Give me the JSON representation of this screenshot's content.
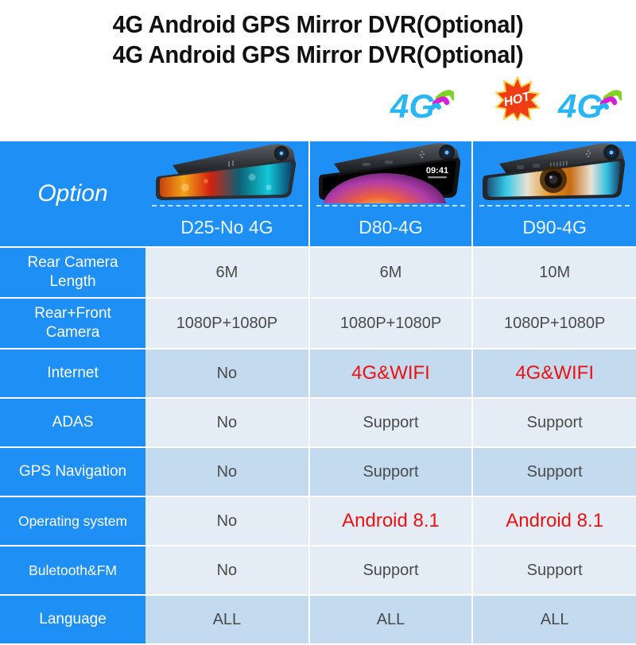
{
  "title": {
    "line1": "4G Android GPS Mirror DVR(Optional)",
    "line2": "4G Android GPS Mirror DVR(Optional)"
  },
  "badges": [
    {
      "name": "4g-badge-d80",
      "label": "4G"
    },
    {
      "name": "hot-badge-d90",
      "label": "HOT"
    },
    {
      "name": "4g-badge-d90",
      "label": "4G"
    }
  ],
  "colors": {
    "header_blue": "#1e90f5",
    "row_light": "#e4edf5",
    "row_dark": "#c3daef",
    "accent_red": "#ee1111",
    "value_text": "#4a4a4a",
    "grid_white": "#ffffff"
  },
  "table": {
    "option_header": "Option",
    "products": [
      {
        "name": "D25-No 4G"
      },
      {
        "name": "D80-4G"
      },
      {
        "name": "D90-4G"
      }
    ],
    "rows": [
      {
        "label": "Rear Camera Length",
        "label_lines": [
          "Rear Camera",
          "Length"
        ],
        "values": [
          "6M",
          "6M",
          "10M"
        ],
        "accent": [
          false,
          false,
          false
        ],
        "shade": "light"
      },
      {
        "label": "Rear+Front Camera",
        "label_lines": [
          "Rear+Front",
          "Camera"
        ],
        "values": [
          "1080P+1080P",
          "1080P+1080P",
          "1080P+1080P"
        ],
        "accent": [
          false,
          false,
          false
        ],
        "shade": "light"
      },
      {
        "label": "Internet",
        "label_lines": [
          "Internet"
        ],
        "values": [
          "No",
          "4G&WIFI",
          "4G&WIFI"
        ],
        "accent": [
          false,
          true,
          true
        ],
        "shade": "dark"
      },
      {
        "label": "ADAS",
        "label_lines": [
          "ADAS"
        ],
        "values": [
          "No",
          "Support",
          "Support"
        ],
        "accent": [
          false,
          false,
          false
        ],
        "shade": "light"
      },
      {
        "label": "GPS Navigation",
        "label_lines": [
          "GPS Navigation"
        ],
        "values": [
          "No",
          "Support",
          "Support"
        ],
        "accent": [
          false,
          false,
          false
        ],
        "shade": "dark"
      },
      {
        "label": "Operating system",
        "label_lines": [
          "Operating system"
        ],
        "values": [
          "No",
          "Android 8.1",
          "Android 8.1"
        ],
        "accent": [
          false,
          true,
          true
        ],
        "shade": "light"
      },
      {
        "label": "Buletooth&FM",
        "label_lines": [
          "Buletooth&FM"
        ],
        "values": [
          "No",
          "Support",
          "Support"
        ],
        "accent": [
          false,
          false,
          false
        ],
        "shade": "light"
      },
      {
        "label": "Language",
        "label_lines": [
          "Language"
        ],
        "values": [
          "ALL",
          "ALL",
          "ALL"
        ],
        "accent": [
          false,
          false,
          false
        ],
        "shade": "dark"
      }
    ]
  },
  "device_screen": {
    "d80_clock": "09:41"
  }
}
